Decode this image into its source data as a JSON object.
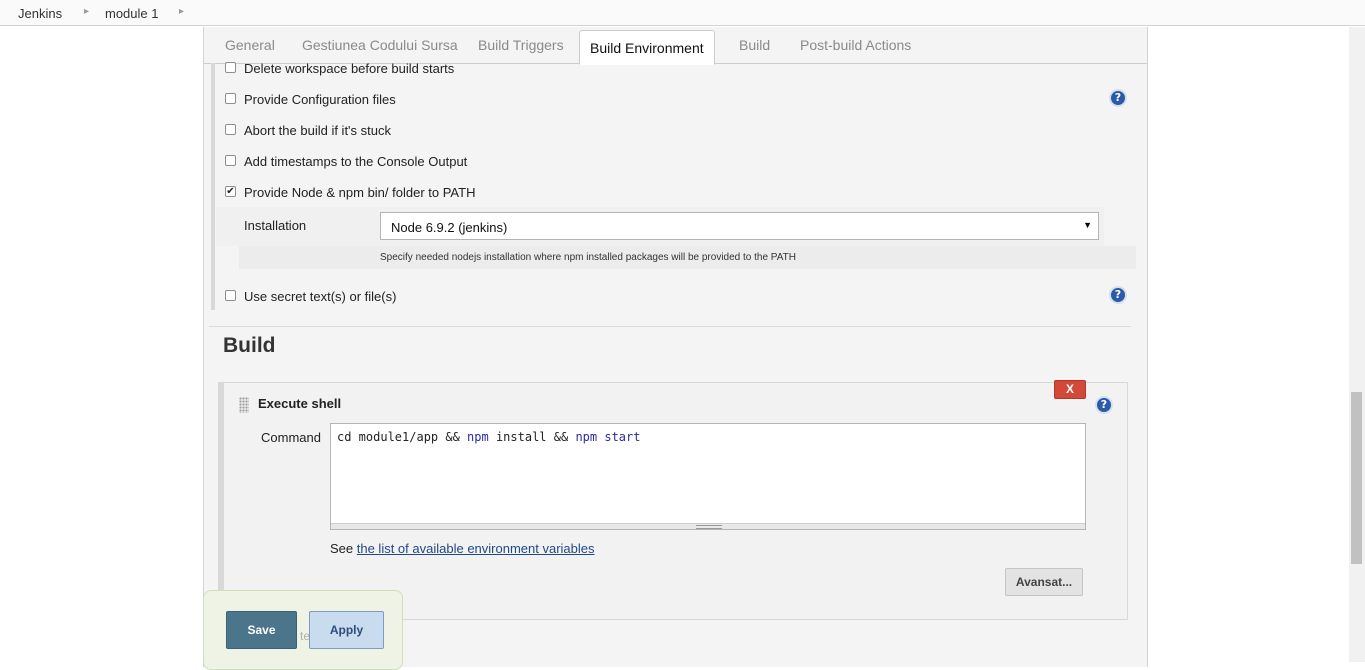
{
  "breadcrumb": {
    "items": [
      "Jenkins",
      "module 1"
    ],
    "separator": "▸"
  },
  "tabs": [
    {
      "label": "General"
    },
    {
      "label": "Gestiunea Codului Sursa"
    },
    {
      "label": "Build Triggers"
    },
    {
      "label": "Build Environment",
      "active": true
    },
    {
      "label": "Build"
    },
    {
      "label": "Post-build Actions"
    }
  ],
  "build_environment": {
    "options": [
      {
        "label": "Delete workspace before build starts",
        "checked": false
      },
      {
        "label": "Provide Configuration files",
        "checked": false
      },
      {
        "label": "Abort the build if it's stuck",
        "checked": false
      },
      {
        "label": "Add timestamps to the Console Output",
        "checked": false
      },
      {
        "label": "Provide Node & npm bin/ folder to PATH",
        "checked": true
      },
      {
        "label": "Use secret text(s) or file(s)",
        "checked": false
      }
    ],
    "installation": {
      "label": "Installation",
      "selected": "Node 6.9.2 (jenkins)",
      "hint": "Specify needed nodejs installation where npm installed packages will be provided to the PATH"
    }
  },
  "build": {
    "title": "Build",
    "step": {
      "title": "Execute shell",
      "delete_label": "X",
      "command_label": "Command",
      "command_parts": [
        "cd module1/app && ",
        "npm",
        " install && ",
        "npm",
        " ",
        "start"
      ],
      "env_prefix": "See ",
      "env_link": "the list of available environment variables",
      "advanced_label": "Avansat..."
    }
  },
  "footer": {
    "save_label": "Save",
    "apply_label": "Apply",
    "ghost_text": "te"
  },
  "icons": {
    "help": "?",
    "check": "✔",
    "dropdown": "▼"
  },
  "colors": {
    "save": "#4b758b",
    "apply": "#c9dbee",
    "delete": "#d24939",
    "help": "#2b5aa7",
    "link": "#204a87"
  }
}
